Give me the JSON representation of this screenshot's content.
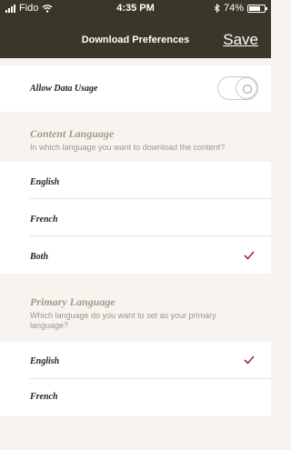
{
  "status_bar": {
    "carrier": "Fido",
    "time": "4:35 PM",
    "battery": "74%"
  },
  "header": {
    "title": "Download Preferences",
    "save_label": "Save"
  },
  "data_usage": {
    "label": "Allow Data Usage",
    "enabled": false
  },
  "content_language": {
    "title": "Content Language",
    "subtitle": "In which language you want to download the content?",
    "options": [
      {
        "label": "English",
        "selected": false
      },
      {
        "label": "French",
        "selected": false
      },
      {
        "label": "Both",
        "selected": true
      }
    ]
  },
  "primary_language": {
    "title": "Primary Language",
    "subtitle": "Which language do you want to set as your primary language?",
    "options": [
      {
        "label": "English",
        "selected": true
      },
      {
        "label": "French",
        "selected": false
      }
    ]
  },
  "colors": {
    "header_bg": "#3a3628",
    "accent": "#a3224a",
    "page_bg": "#f7f4f0"
  },
  "icons": [
    "signal-icon",
    "wifi-icon",
    "bluetooth-icon",
    "battery-icon",
    "checkmark-icon"
  ]
}
